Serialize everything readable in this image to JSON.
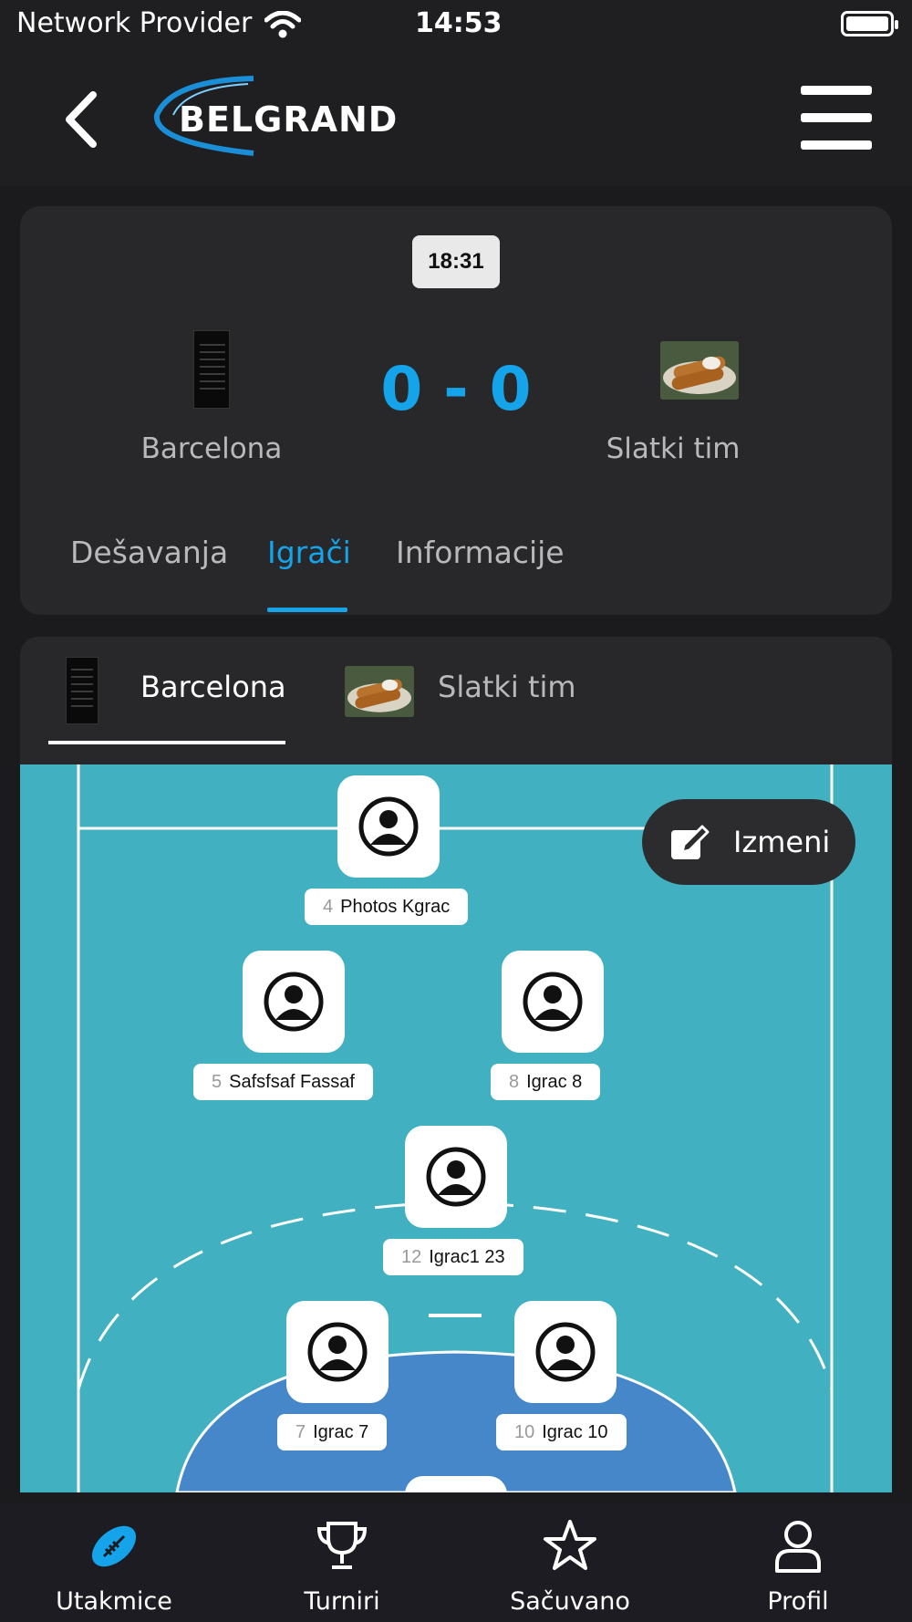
{
  "status_bar": {
    "carrier": "Network Provider",
    "time": "14:53"
  },
  "header": {
    "logo_text": "BELGRAND"
  },
  "match": {
    "time": "18:31",
    "home_team": "Barcelona",
    "away_team": "Slatki tim",
    "score": "0 - 0",
    "tabs": [
      {
        "label": "Dešavanja",
        "active": false
      },
      {
        "label": "Igrači",
        "active": true
      },
      {
        "label": "Informacije",
        "active": false
      }
    ]
  },
  "lineup": {
    "team_tabs": [
      {
        "label": "Barcelona",
        "active": true
      },
      {
        "label": "Slatki tim",
        "active": false
      }
    ],
    "edit_label": "Izmeni",
    "players": [
      {
        "number": "4",
        "name": "Photos Kgrac"
      },
      {
        "number": "5",
        "name": "Safsfsaf Fassaf"
      },
      {
        "number": "8",
        "name": "Igrac 8"
      },
      {
        "number": "12",
        "name": "Igrac1 23"
      },
      {
        "number": "7",
        "name": "Igrac 7"
      },
      {
        "number": "10",
        "name": "Igrac 10"
      }
    ]
  },
  "bottom_nav": [
    {
      "label": "Utakmice",
      "icon": "football-icon",
      "active": true
    },
    {
      "label": "Turniri",
      "icon": "trophy-icon",
      "active": false
    },
    {
      "label": "Sačuvano",
      "icon": "star-icon",
      "active": false
    },
    {
      "label": "Profil",
      "icon": "user-icon",
      "active": false
    }
  ],
  "colors": {
    "accent": "#15a4e9",
    "court": "#41b1c1",
    "background": "#1b1b1d",
    "card": "#28282a"
  }
}
